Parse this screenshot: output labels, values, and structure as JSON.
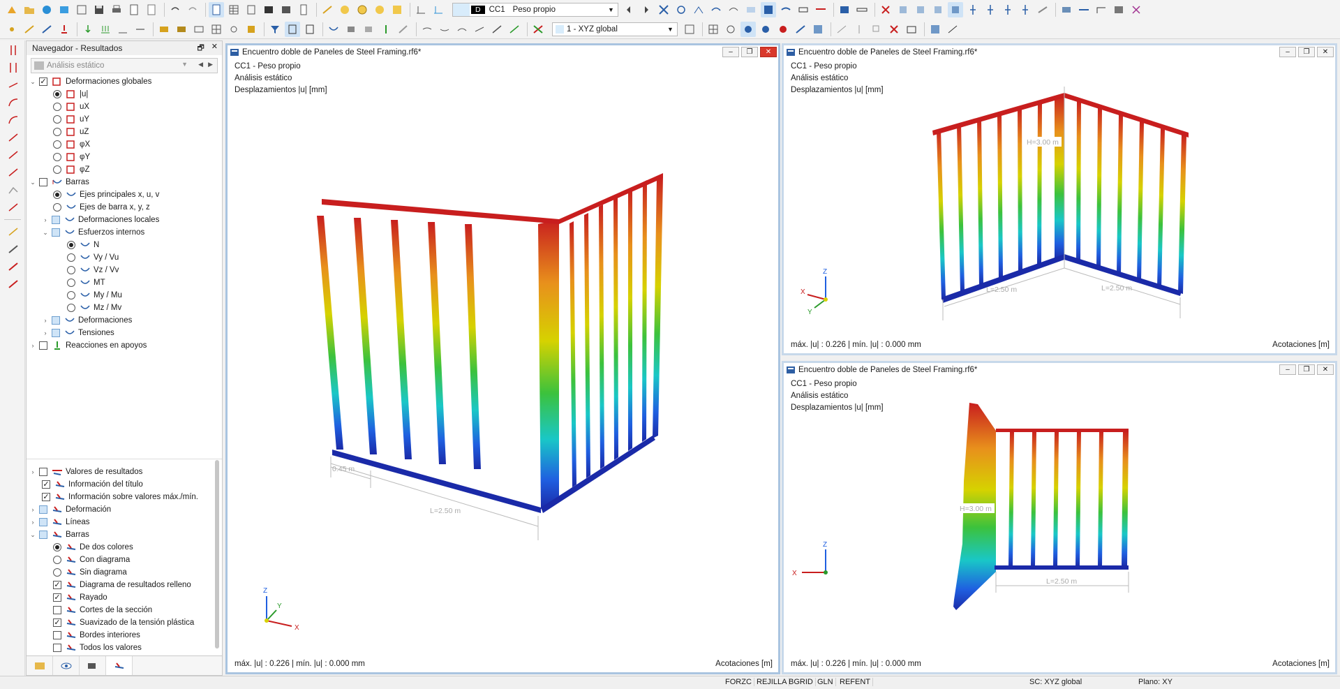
{
  "toolbar": {
    "load_case_tag": "D",
    "load_case_code": "CC1",
    "load_case_name": "Peso propio",
    "view_combo": "1 - XYZ global"
  },
  "navigator": {
    "title": "Navegador - Resultados",
    "analysis_combo": "Análisis estático",
    "top_items": [
      {
        "label": "Deformaciones globales"
      },
      {
        "label": "|u|"
      },
      {
        "label": "uX"
      },
      {
        "label": "uY"
      },
      {
        "label": "uZ"
      },
      {
        "label": "φX"
      },
      {
        "label": "φY"
      },
      {
        "label": "φZ"
      },
      {
        "label": "Barras"
      },
      {
        "label": "Ejes principales x, u, v"
      },
      {
        "label": "Ejes de barra x, y, z"
      },
      {
        "label": "Deformaciones locales"
      },
      {
        "label": "Esfuerzos internos"
      },
      {
        "label": "N"
      },
      {
        "label": "Vy / Vu"
      },
      {
        "label": "Vz / Vv"
      },
      {
        "label": "MT"
      },
      {
        "label": "My / Mu"
      },
      {
        "label": "Mz / Mv"
      },
      {
        "label": "Deformaciones"
      },
      {
        "label": "Tensiones"
      },
      {
        "label": "Reacciones en apoyos"
      }
    ],
    "bottom_items": [
      {
        "label": "Valores de resultados"
      },
      {
        "label": "Información del título"
      },
      {
        "label": "Información sobre valores máx./mín."
      },
      {
        "label": "Deformación"
      },
      {
        "label": "Líneas"
      },
      {
        "label": "Barras"
      },
      {
        "label": "De dos colores"
      },
      {
        "label": "Con diagrama"
      },
      {
        "label": "Sin diagrama"
      },
      {
        "label": "Diagrama de resultados relleno"
      },
      {
        "label": "Rayado"
      },
      {
        "label": "Cortes de la sección"
      },
      {
        "label": "Suavizado de la tensión plástica"
      },
      {
        "label": "Bordes interiores"
      },
      {
        "label": "Todos los valores"
      }
    ]
  },
  "windows": {
    "main": {
      "title": "Encuentro doble de Paneles de Steel Framing.rf6*",
      "line1": "CC1 - Peso propio",
      "line2": "Análisis estático",
      "line3": "Desplazamientos |u| [mm]",
      "footer_left": "máx. |u| : 0.226 | mín. |u| : 0.000 mm",
      "footer_right": "Acotaciones [m]",
      "dim1": "0.45 m",
      "dim2": "L=2.50 m"
    },
    "top_right": {
      "title": "Encuentro doble de Paneles de Steel Framing.rf6*",
      "line1": "CC1 - Peso propio",
      "line2": "Análisis estático",
      "line3": "Desplazamientos |u| [mm]",
      "footer_left": "máx. |u| : 0.226 | mín. |u| : 0.000 mm",
      "footer_right": "Acotaciones [m]",
      "dim_h": "H=3.00 m",
      "dim_l1": "L=2.50 m",
      "dim_l2": "L=2.50 m"
    },
    "bottom_right": {
      "title": "Encuentro doble de Paneles de Steel Framing.rf6*",
      "line1": "CC1 - Peso propio",
      "line2": "Análisis estático",
      "line3": "Desplazamientos |u| [mm]",
      "footer_left": "máx. |u| : 0.226 | mín. |u| : 0.000 mm",
      "footer_right": "Acotaciones [m]",
      "dim_h": "H=3.00 m",
      "dim_l": "L=2.50 m"
    }
  },
  "axes": {
    "x": "X",
    "y": "Y",
    "z": "Z"
  },
  "statusbar": {
    "forzc": "FORZC",
    "rejilla": "REJILLA",
    "bgrid": "BGRID",
    "gln": "GLN",
    "refent": "REFENT",
    "sc": "SC: XYZ global",
    "plano": "Plano: XY"
  },
  "colors": {
    "deform_max": "#c81e1e",
    "deform_mid": "#d6d200",
    "deform_min": "#1a2aa8",
    "window_border": "#a9c4e0"
  }
}
